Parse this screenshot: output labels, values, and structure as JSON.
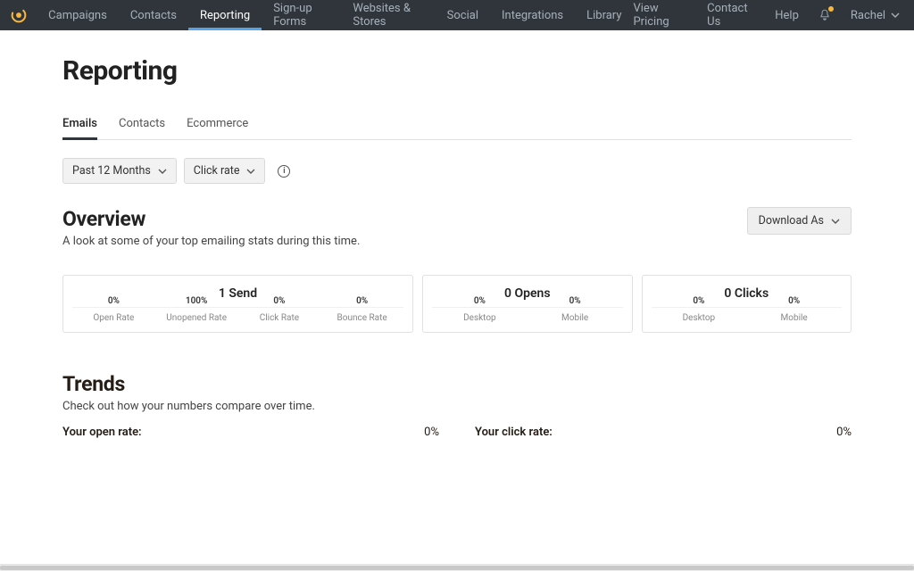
{
  "nav": {
    "items": [
      "Campaigns",
      "Contacts",
      "Reporting",
      "Sign-up Forms",
      "Websites & Stores",
      "Social",
      "Integrations",
      "Library"
    ],
    "activeIndex": 2,
    "right": {
      "pricing": "View Pricing",
      "contact": "Contact Us",
      "help": "Help",
      "user": "Rachel"
    }
  },
  "page": {
    "title": "Reporting",
    "subtabs": [
      "Emails",
      "Contacts",
      "Ecommerce"
    ],
    "activeSubtab": 0,
    "filters": {
      "range": "Past 12 Months",
      "metric": "Click rate"
    },
    "overview": {
      "heading": "Overview",
      "subheading": "A look at some of your top emailing stats during this time.",
      "download": "Download As"
    },
    "trends": {
      "heading": "Trends",
      "subheading": "Check out how your numbers compare over time.",
      "open_label": "Your open rate:",
      "open_value": "0%",
      "click_label": "Your click rate:",
      "click_value": "0%"
    }
  },
  "chart_data": [
    {
      "type": "bar",
      "title": "1 Send",
      "categories": [
        "Open Rate",
        "Unopened Rate",
        "Click Rate",
        "Bounce Rate"
      ],
      "values": [
        0,
        100,
        0,
        0
      ],
      "value_labels": [
        "0%",
        "100%",
        "0%",
        "0%"
      ],
      "ylim": [
        0,
        100
      ]
    },
    {
      "type": "bar",
      "title": "0 Opens",
      "categories": [
        "Desktop",
        "Mobile"
      ],
      "values": [
        0,
        0
      ],
      "value_labels": [
        "0%",
        "0%"
      ],
      "ylim": [
        0,
        100
      ]
    },
    {
      "type": "bar",
      "title": "0 Clicks",
      "categories": [
        "Desktop",
        "Mobile"
      ],
      "values": [
        0,
        0
      ],
      "value_labels": [
        "0%",
        "0%"
      ],
      "ylim": [
        0,
        100
      ]
    }
  ]
}
